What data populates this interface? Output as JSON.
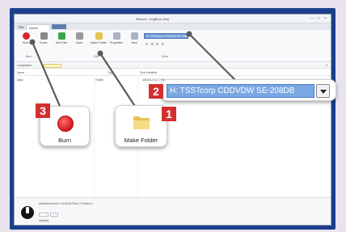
{
  "window": {
    "title": "Recent... ImgBurn (Ha)",
    "controls": "– □ ×",
    "tabs": {
      "file": "File",
      "active": "Home",
      "extra": ""
    }
  },
  "ribbon": {
    "buttons": [
      {
        "label": "Burn",
        "icon": "burn-icon",
        "color": "#d62828"
      },
      {
        "label": "Erase",
        "icon": "erase-icon",
        "color": "#888888"
      },
      {
        "label": "Add Files",
        "icon": "add-icon",
        "color": "#3fa34d"
      },
      {
        "label": "Open",
        "icon": "open-icon",
        "color": "#999999"
      },
      {
        "label": "Make Folder",
        "icon": "folder-icon",
        "color": "#e7c255"
      },
      {
        "label": "Properties",
        "icon": "properties-icon",
        "color": "#aab4c3"
      },
      {
        "label": "View",
        "icon": "view-icon",
        "color": "#aab4c3"
      }
    ],
    "groups": [
      "Burn",
      "Edit",
      "Drive"
    ],
    "drive_small": "H: TSSTcorp CDDVDW SE-208DB",
    "mini_tools": "↻ ⊞ ⊟ ⚙"
  },
  "pathbar": {
    "label": "Compilation",
    "end": "▾"
  },
  "columns": [
    "Name",
    "Type",
    "Size Modified"
  ],
  "files": [
    {
      "name": "Data",
      "type": "Folder",
      "date": "4/5/2012 6:17 PM"
    }
  ],
  "status": {
    "line1": "Added/removed: 1/4/2016 Files 0 Folders 2",
    "line2": "",
    "line3": "Nothing"
  },
  "callouts": {
    "burn": {
      "badge": "3",
      "label": "Burn"
    },
    "folder": {
      "badge": "1",
      "label": "Make Folder"
    },
    "drive": {
      "badge": "2",
      "value": "H: TSSTcorp CDDVDW SE-208DB"
    }
  },
  "colors": {
    "frame": "#1b3f8a",
    "badge": "#d32f2f",
    "drive_highlight": "#7aa7e3"
  }
}
